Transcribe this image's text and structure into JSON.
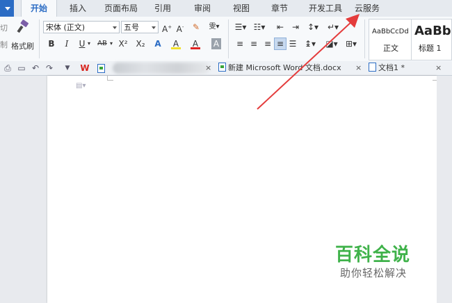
{
  "menubar": {
    "tabs": [
      "开始",
      "插入",
      "页面布局",
      "引用",
      "审阅",
      "视图",
      "章节",
      "开发工具",
      "云服务"
    ],
    "active_tab": "开始"
  },
  "ribbon": {
    "clipboard": {
      "cut_label": "切",
      "paste_label": "制",
      "format_painter_label": "格式刷"
    },
    "font": {
      "font_name": "宋体 (正文)",
      "font_size": "五号",
      "buttons": [
        "B",
        "I",
        "U",
        "AB",
        "X²",
        "X₂",
        "A",
        "A",
        "A"
      ]
    },
    "styles": [
      {
        "preview": "AaBbCcDd",
        "name": "正文"
      },
      {
        "preview": "AaBb",
        "name": "标题 1"
      }
    ]
  },
  "doc_tabs": [
    {
      "title": "新建 Microsoft Word 文档.docx",
      "close": "×"
    },
    {
      "title": "文档1 *",
      "close": "×"
    }
  ],
  "watermark": {
    "title": "百科全说",
    "subtitle": "助你轻松解决"
  },
  "colors": {
    "accent": "#2b6cc4",
    "arrow": "#e43c3c",
    "watermark": "#3fb24a"
  }
}
